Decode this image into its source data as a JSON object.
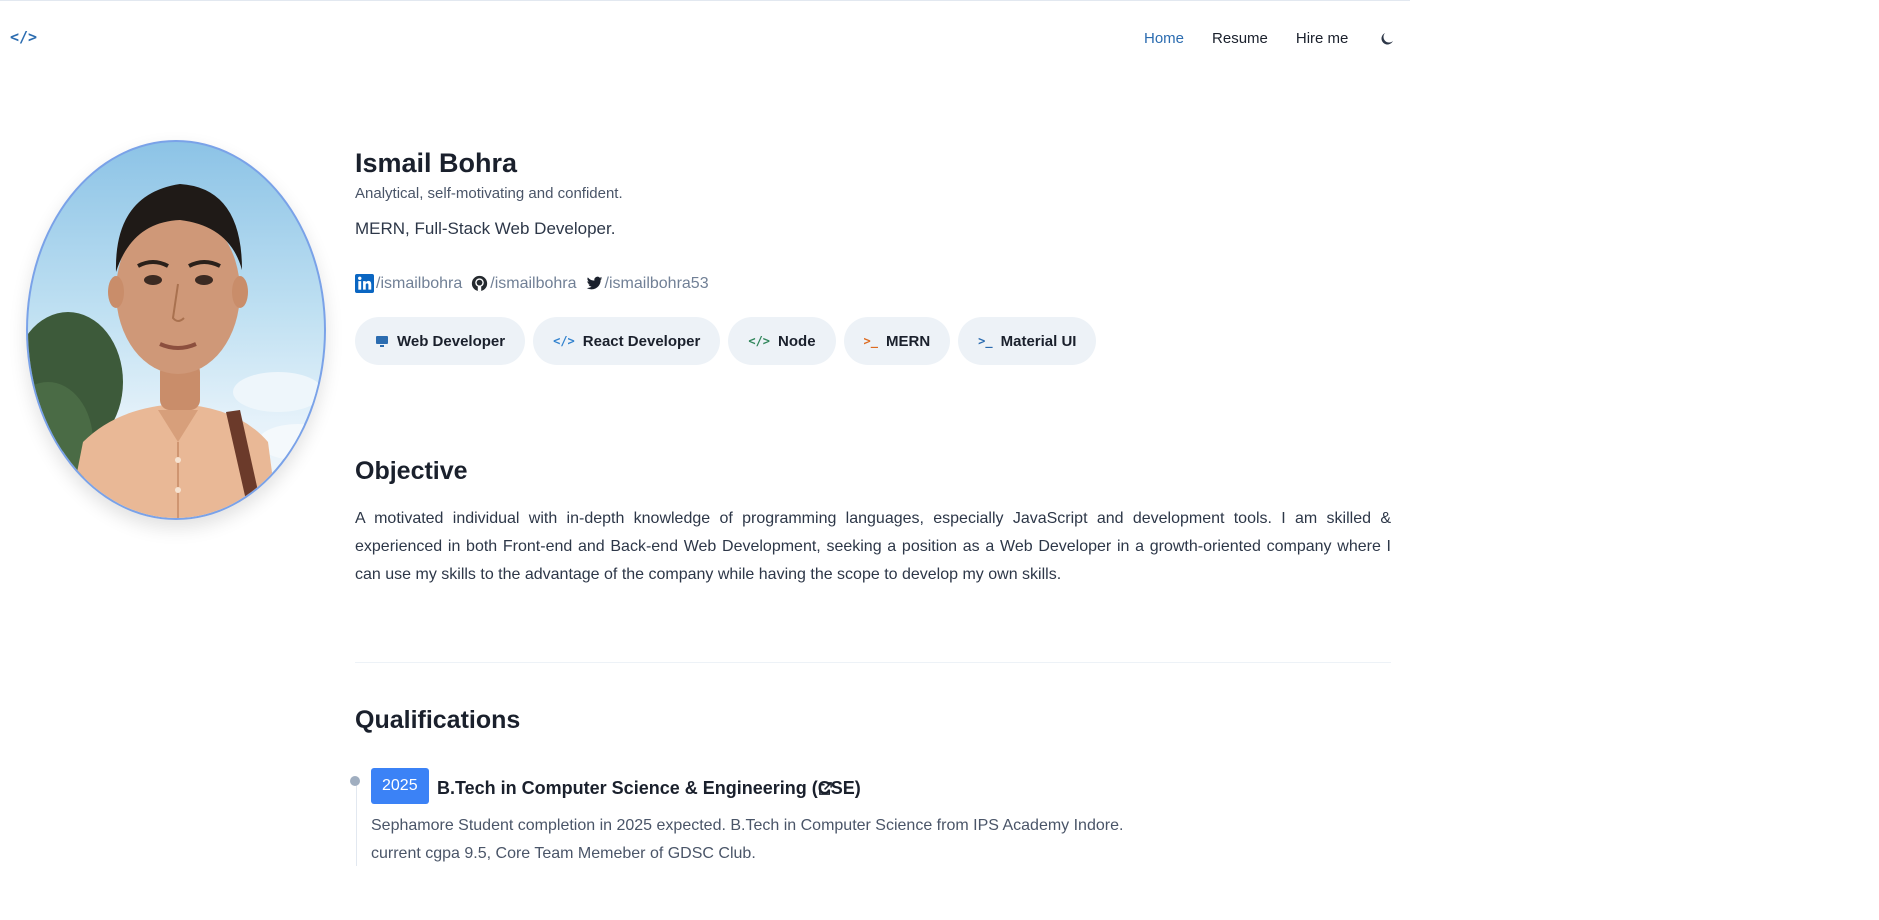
{
  "header": {
    "logo": "</>",
    "nav": [
      {
        "label": "Home",
        "active": true
      },
      {
        "label": "Resume",
        "active": false
      },
      {
        "label": "Hire me",
        "active": false
      }
    ],
    "theme_toggle_icon": "moon-icon"
  },
  "profile": {
    "name": "Ismail Bohra",
    "tagline": "Analytical, self-motivating and confident.",
    "role": "MERN, Full-Stack Web Developer.",
    "photo_icon": "profile-photo",
    "socials": [
      {
        "icon": "linkedin-icon",
        "label": "/ismailbohra"
      },
      {
        "icon": "github-icon",
        "label": "/ismailbohra"
      },
      {
        "icon": "twitter-icon",
        "label": "/ismailbohra53"
      }
    ],
    "skills": [
      {
        "label": "Web Developer",
        "icon": "monitor-icon",
        "color": "#2b6cb0"
      },
      {
        "label": "React Developer",
        "icon": "code-icon",
        "color": "#3182ce"
      },
      {
        "label": "Node",
        "icon": "code-icon",
        "color": "#2f855a"
      },
      {
        "label": "MERN",
        "icon": "terminal-icon",
        "color": "#dd6b20"
      },
      {
        "label": "Material UI",
        "icon": "terminal-icon",
        "color": "#2b6cb0"
      }
    ]
  },
  "objective": {
    "heading": "Objective",
    "text": "A motivated individual with in-depth knowledge of programming languages, especially JavaScript and development tools. I am skilled & experienced in both Front-end and Back-end Web Development, seeking a position as a Web Developer in a growth-oriented company where I can use my skills to the advantage of the company while having the scope to develop my own skills."
  },
  "qualifications": {
    "heading": "Qualifications",
    "items": [
      {
        "year": "2025",
        "title": "B.Tech in Computer Science & Engineering (CSE)",
        "description": "Sephamore Student completion in 2025 expected. B.Tech in Computer Science from IPS Academy Indore. current cgpa 9.5, Core Team Memeber of GDSC Club."
      }
    ]
  },
  "colors": {
    "accent": "#2b6cb0",
    "badge": "#3b82f6",
    "chip_bg": "#edf2f7"
  }
}
